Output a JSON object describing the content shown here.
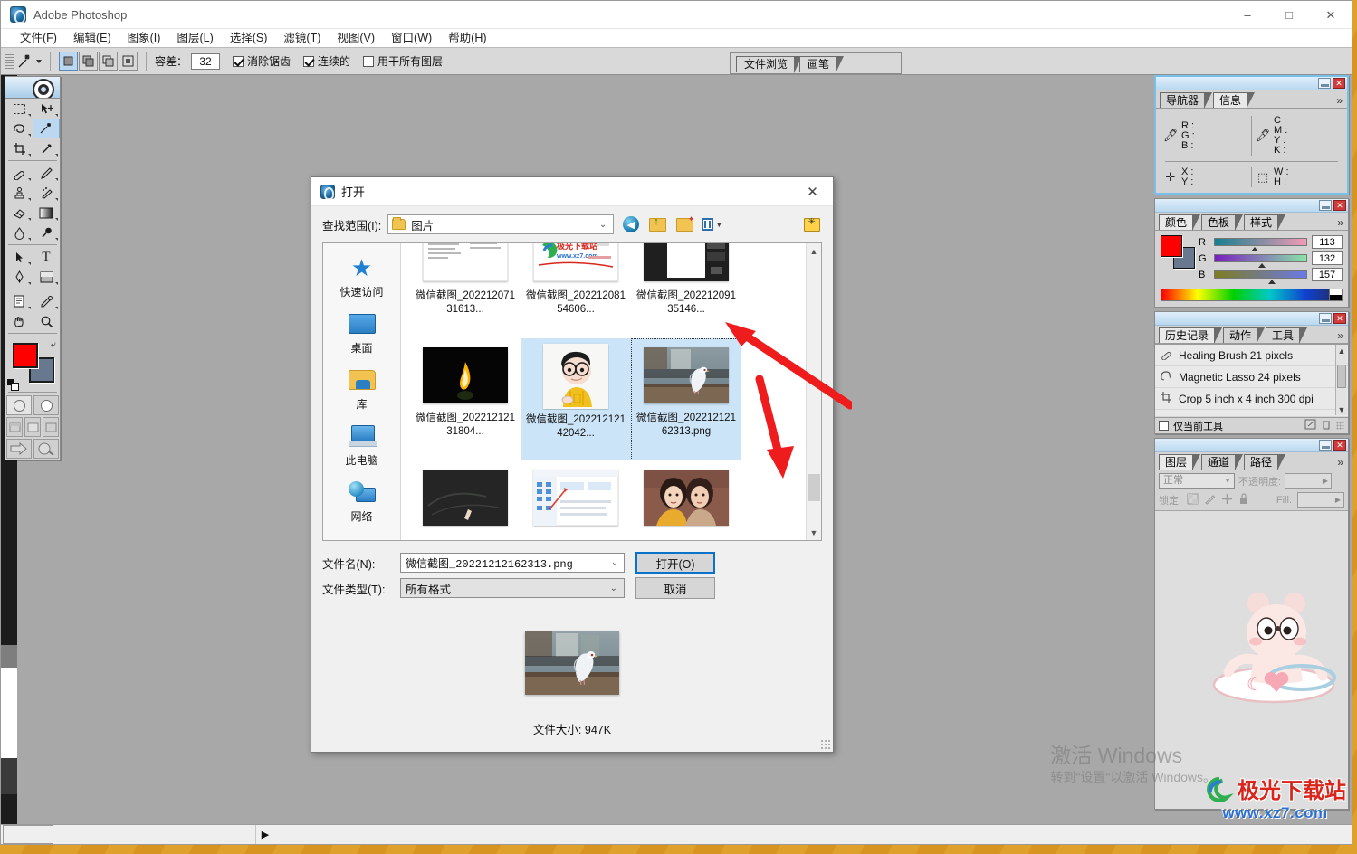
{
  "app": {
    "title": "Adobe Photoshop",
    "logo_icon": "photoshop-icon",
    "window_controls": {
      "minimize": "–",
      "maximize": "□",
      "close": "✕"
    }
  },
  "menubar": {
    "items": [
      {
        "label": "文件(F)"
      },
      {
        "label": "编辑(E)"
      },
      {
        "label": "图象(I)"
      },
      {
        "label": "图层(L)"
      },
      {
        "label": "选择(S)"
      },
      {
        "label": "滤镜(T)"
      },
      {
        "label": "视图(V)"
      },
      {
        "label": "窗口(W)"
      },
      {
        "label": "帮助(H)"
      }
    ]
  },
  "options_bar": {
    "active_tool_icon": "magic-wand-icon",
    "tolerance_label": "容差：",
    "tolerance_value": "32",
    "anti_alias_label": "消除锯齿",
    "anti_alias_checked": true,
    "contiguous_label": "连续的",
    "contiguous_checked": true,
    "all_layers_label": "用干所有图层",
    "all_layers_checked": false,
    "palette_tabs": [
      {
        "label": "文件浏览"
      },
      {
        "label": "画笔"
      }
    ]
  },
  "toolbox": {
    "tools": [
      {
        "name": "marquee-tool",
        "glyph": "▭"
      },
      {
        "name": "move-tool",
        "glyph": "✥"
      },
      {
        "name": "lasso-tool",
        "glyph": "✍"
      },
      {
        "name": "magic-wand-tool",
        "glyph": "✨",
        "active": true
      },
      {
        "name": "crop-tool",
        "glyph": "⌗"
      },
      {
        "name": "slice-tool",
        "glyph": "✂"
      },
      {
        "name": "healing-brush-tool",
        "glyph": "✏"
      },
      {
        "name": "brush-tool",
        "glyph": "🖌"
      },
      {
        "name": "clone-stamp-tool",
        "glyph": "⎙"
      },
      {
        "name": "history-brush-tool",
        "glyph": "✎"
      },
      {
        "name": "eraser-tool",
        "glyph": "▰"
      },
      {
        "name": "gradient-tool",
        "glyph": "▤"
      },
      {
        "name": "blur-tool",
        "glyph": "💧"
      },
      {
        "name": "dodge-tool",
        "glyph": "🔍"
      },
      {
        "name": "path-selection-tool",
        "glyph": "➤"
      },
      {
        "name": "type-tool",
        "glyph": "T"
      },
      {
        "name": "pen-tool",
        "glyph": "✒"
      },
      {
        "name": "shape-tool",
        "glyph": "▢"
      },
      {
        "name": "notes-tool",
        "glyph": "📄"
      },
      {
        "name": "eyedropper-tool",
        "glyph": "💉"
      },
      {
        "name": "hand-tool",
        "glyph": "✋"
      },
      {
        "name": "zoom-tool",
        "glyph": "🔍"
      }
    ],
    "foreground_color": "#ff0000",
    "background_color": "#68798f"
  },
  "dock": {
    "info_panel": {
      "tabs": [
        {
          "label": "导航器",
          "selected": false
        },
        {
          "label": "信息",
          "selected": true
        }
      ],
      "more": "»",
      "rgb": {
        "r": "R :",
        "g": "G :",
        "b": "B :"
      },
      "cmyk": {
        "c": "C :",
        "m": "M :",
        "y": "Y :",
        "k": "K :"
      },
      "xy": {
        "x": "X :",
        "y": "Y :"
      },
      "wh": {
        "w": "W :",
        "h": "H :"
      }
    },
    "color_panel": {
      "tabs": [
        {
          "label": "颜色",
          "selected": true
        },
        {
          "label": "色板",
          "selected": false
        },
        {
          "label": "样式",
          "selected": false
        }
      ],
      "more": "»",
      "sliders": [
        {
          "label": "R",
          "value": "113"
        },
        {
          "label": "G",
          "value": "132"
        },
        {
          "label": "B",
          "value": "157"
        }
      ],
      "foreground_color": "#ff0000",
      "background_color": "#68798f"
    },
    "history_panel": {
      "tabs": [
        {
          "label": "历史记录",
          "selected": true
        },
        {
          "label": "动作",
          "selected": false
        },
        {
          "label": "工具",
          "selected": false
        }
      ],
      "more": "»",
      "items": [
        {
          "icon": "healing-brush-icon",
          "label": "Healing Brush 21 pixels"
        },
        {
          "icon": "magnetic-lasso-icon",
          "label": "Magnetic Lasso 24 pixels"
        },
        {
          "icon": "crop-icon",
          "label": "Crop 5 inch x 4 inch 300 dpi"
        }
      ],
      "footer_checkbox_label": "仅当前工具",
      "footer_checked": false
    },
    "layers_panel": {
      "tabs": [
        {
          "label": "图层",
          "selected": true
        },
        {
          "label": "通道",
          "selected": false
        },
        {
          "label": "路径",
          "selected": false
        }
      ],
      "more": "»",
      "blend_mode": "正常",
      "opacity_label": "不透明度:",
      "opacity_value": "",
      "lock_label": "锁定:",
      "fill_label": "Fill:",
      "fill_value": ""
    }
  },
  "open_dialog": {
    "title": "打开",
    "title_icon": "photoshop-icon",
    "close_icon": "close-icon",
    "look_in_label": "查找范围(I):",
    "look_in_value": "图片",
    "toolbar_icons": [
      {
        "name": "back-icon"
      },
      {
        "name": "up-folder-icon"
      },
      {
        "name": "new-folder-icon"
      },
      {
        "name": "view-mode-icon"
      },
      {
        "name": "photoshop-thumbnail-icon"
      }
    ],
    "places": [
      {
        "icon": "quick-access-icon",
        "label": "快速访问"
      },
      {
        "icon": "desktop-icon",
        "label": "桌面"
      },
      {
        "icon": "library-icon",
        "label": "库"
      },
      {
        "icon": "this-pc-icon",
        "label": "此电脑"
      },
      {
        "icon": "network-icon",
        "label": "网络"
      }
    ],
    "files": [
      {
        "name": "微信截图_20221207131613...",
        "thumb": "document-screenshot",
        "state": "normal"
      },
      {
        "name": "微信截图_20221208154606...",
        "thumb": "xz7-logo-screenshot",
        "state": "normal"
      },
      {
        "name": "微信截图_20221209135146...",
        "thumb": "dark-ui-screenshot",
        "state": "normal"
      },
      {
        "name": "微信截图_20221212131804...",
        "thumb": "candle-flame",
        "state": "normal"
      },
      {
        "name": "微信截图_20221212142042...",
        "thumb": "cartoon-boy",
        "state": "selected"
      },
      {
        "name": "微信截图_20221212162313.png",
        "thumb": "white-pigeon",
        "state": "focused"
      },
      {
        "name": "",
        "thumb": "blackboard",
        "state": "normal"
      },
      {
        "name": "",
        "thumb": "file-explorer",
        "state": "normal"
      },
      {
        "name": "",
        "thumb": "two-women",
        "state": "normal"
      }
    ],
    "file_name_label": "文件名(N):",
    "file_name_value": "微信截图_20221212162313.png",
    "file_type_label": "文件类型(T):",
    "file_type_value": "所有格式",
    "open_button": "打开(O)",
    "cancel_button": "取消",
    "preview_thumb": "white-pigeon",
    "file_size_text": "文件大小: 947K"
  },
  "watermarks": {
    "windows_activate_line1": "激活 Windows",
    "windows_activate_line2": "转到\"设置\"以激活 Windows。",
    "site_name": "极光下载站",
    "site_url": "www.xz7.com"
  },
  "statusbar": {
    "value": "",
    "play_icon": "play-icon"
  }
}
